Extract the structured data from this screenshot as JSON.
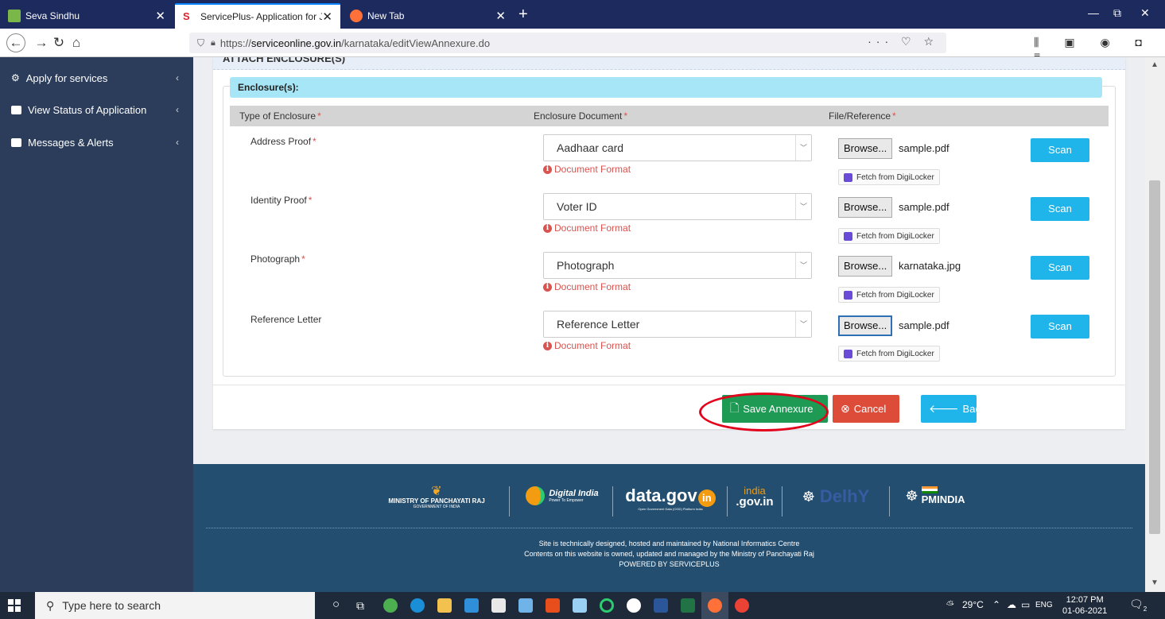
{
  "browser": {
    "tabs": [
      {
        "title": "Seva Sindhu",
        "close": "✕"
      },
      {
        "title": "ServicePlus- Application for Jo",
        "close": "✕"
      },
      {
        "title": "New Tab",
        "close": "✕"
      }
    ],
    "new_tab": "+",
    "window_controls": {
      "minimize": "—",
      "maximize": "⧉",
      "close": "✕"
    },
    "url_prefix": "https://",
    "url_domain": "serviceonline.gov.in",
    "url_path": "/karnataka/editViewAnnexure.do",
    "url_actions": "··· ♡ ☆",
    "toolbar_icons": "⫼ ▣ ◉ ◘ ≡"
  },
  "sidebar": {
    "items": [
      {
        "label": "Apply for services",
        "icon": "cogs-icon"
      },
      {
        "label": "View Status of Application",
        "icon": "list-icon"
      },
      {
        "label": "Messages & Alerts",
        "icon": "message-icon"
      }
    ],
    "chevron": "‹"
  },
  "form": {
    "section_header": "ATTACH ENCLOSURE(S)",
    "panel_title": "Enclosure(s):",
    "columns": {
      "type": "Type of Enclosure",
      "document": "Enclosure Document",
      "file": "File/Reference"
    },
    "required_mark": "*",
    "rows": [
      {
        "type": "Address Proof",
        "required": true,
        "document": "Aadhaar card",
        "doc_format": "Document Format",
        "browse": "Browse...",
        "file": "sample.pdf",
        "digilocker": "Fetch from DigiLocker",
        "scan": "Scan"
      },
      {
        "type": "Identity Proof",
        "required": true,
        "document": "Voter ID",
        "doc_format": "Document Format",
        "browse": "Browse...",
        "file": "sample.pdf",
        "digilocker": "Fetch from DigiLocker",
        "scan": "Scan"
      },
      {
        "type": "Photograph",
        "required": true,
        "document": "Photograph",
        "doc_format": "Document Format",
        "browse": "Browse...",
        "file": "karnataka.jpg",
        "digilocker": "Fetch from DigiLocker",
        "scan": "Scan"
      },
      {
        "type": "Reference Letter",
        "required": false,
        "document": "Reference Letter",
        "doc_format": "Document Format",
        "browse": "Browse...",
        "file": "sample.pdf",
        "digilocker": "Fetch from DigiLocker",
        "scan": "Scan"
      }
    ],
    "buttons": {
      "save": "Save Annexure",
      "cancel": "Cancel",
      "back": "Back"
    }
  },
  "footer": {
    "logos": {
      "panchayati": "MINISTRY OF PANCHAYATI RAJ",
      "panchayati_sub": "GOVERNMENT OF INDIA",
      "digital_india": "Digital India",
      "digital_india_sub": "Power To Empower",
      "datagov": "data.gov",
      "datagov_badge": "in",
      "datagov_sub": "Open Government Data (OGD) Platform India",
      "indiagov_top": "india",
      "indiagov_bottom": ".gov.in",
      "delhi": "DelhY",
      "pmindia": "PMINDIA"
    },
    "line1": "Site is technically designed, hosted and maintained by National Informatics Centre",
    "line2": "Contents on this website is owned, updated and managed by the Ministry of Panchayati Raj",
    "line3": "POWERED BY SERVICEPLUS"
  },
  "taskbar": {
    "search_placeholder": "Type here to search",
    "weather": "29°C",
    "language": "ENG",
    "time": "12:07 PM",
    "date": "01-06-2021",
    "notifications": "2"
  },
  "colors": {
    "tabbar": "#1c2a5e",
    "sidebar": "#2b3d5b",
    "panel_title": "#a6e6f6",
    "save": "#1e9a54",
    "cancel": "#dd4b39",
    "back": "#1fb5ea",
    "footer": "#234e6f",
    "highlight": "#e3001b"
  }
}
